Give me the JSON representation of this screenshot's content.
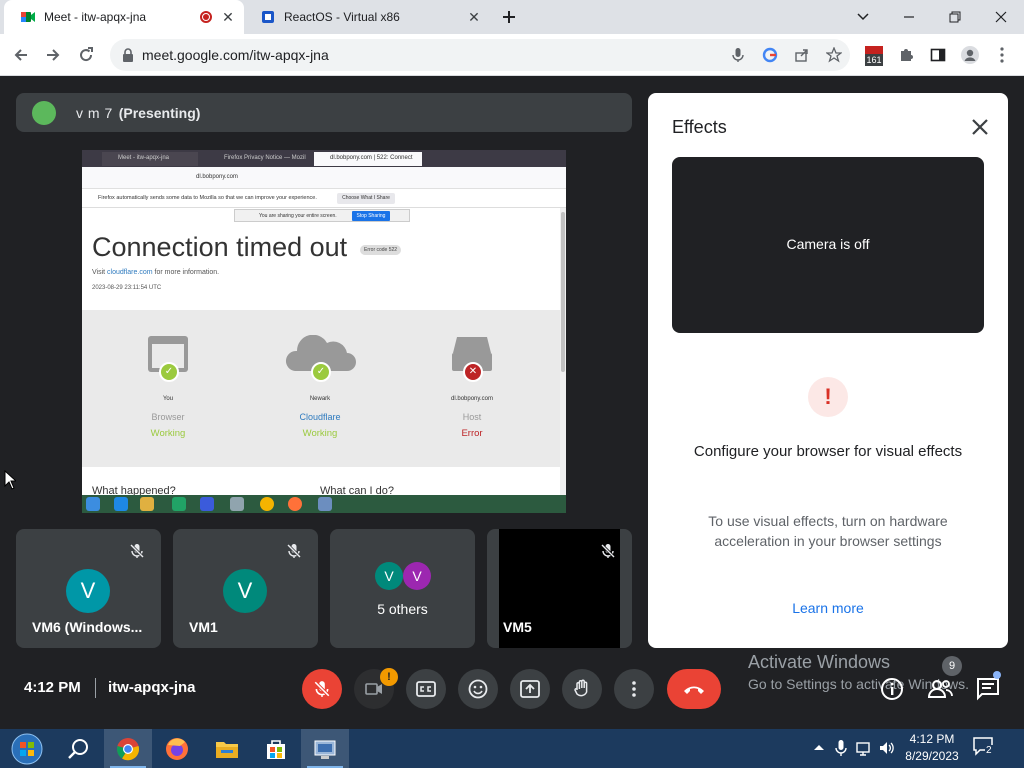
{
  "browser": {
    "tabs": [
      {
        "title": "Meet - itw-apqx-jna",
        "active": true,
        "recording": true
      },
      {
        "title": "ReactOS - Virtual x86",
        "active": false
      }
    ],
    "url": "meet.google.com/itw-apqx-jna",
    "extension_badge": "161"
  },
  "presenter": {
    "name": "v m 7",
    "tag": "(Presenting)"
  },
  "shared_screen": {
    "tab1": "Meet - itw-apqx-jna",
    "tab2": "Firefox Privacy Notice — Mozil",
    "tab3": "dl.bobpony.com | 522: Connect",
    "url": "dl.bobpony.com",
    "notice": "Firefox automatically sends some data to Mozilla so that we can improve your experience.",
    "notice_button": "Choose What I Share",
    "sharing_text": "You are sharing your entire screen.",
    "stop_sharing": "Stop Sharing",
    "title": "Connection timed out",
    "error_code": "Error code 522",
    "visit_prefix": "Visit ",
    "visit_link": "cloudflare.com",
    "visit_suffix": " for more information.",
    "timestamp": "2023-08-29 23:11:54 UTC",
    "nodes": [
      {
        "name": "You",
        "role": "Browser",
        "status": "Working",
        "ok": true
      },
      {
        "name": "Newark",
        "role": "Cloudflare",
        "status": "Working",
        "ok": true
      },
      {
        "name": "dl.bobpony.com",
        "role": "Host",
        "status": "Error",
        "ok": false
      }
    ],
    "what_happened": "What happened?",
    "what_can_i_do": "What can I do?"
  },
  "tiles": [
    {
      "name": "VM6 (Windows...",
      "initial": "V",
      "color": "#0097a7",
      "muted": true
    },
    {
      "name": "VM1",
      "initial": "V",
      "color": "#00897b",
      "muted": true
    },
    {
      "name": "5 others",
      "initials": [
        "V",
        "V"
      ],
      "colors": [
        "#00897b",
        "#9c27b0"
      ]
    },
    {
      "name": "VM5",
      "muted": true
    }
  ],
  "effects": {
    "title": "Effects",
    "camera_off": "Camera is off",
    "heading": "Configure your browser for visual effects",
    "body": "To use visual effects, turn on hardware acceleration in your browser settings",
    "learn_more": "Learn more",
    "warning_glyph": "!"
  },
  "meeting": {
    "time": "4:12 PM",
    "code": "itw-apqx-jna",
    "camera_alert": "!",
    "people_count": "9"
  },
  "watermark": {
    "line1": "Activate Windows",
    "line2": "Go to Settings to activate Windows."
  },
  "taskbar": {
    "time": "4:12 PM",
    "date": "8/29/2023",
    "notifications": "2"
  }
}
